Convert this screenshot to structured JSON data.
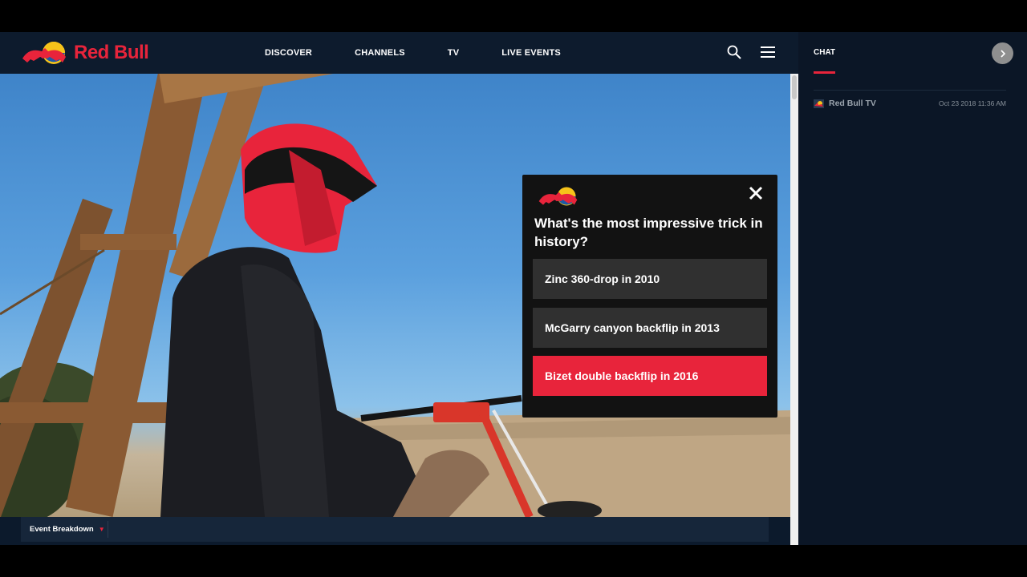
{
  "brand": {
    "name": "Red Bull",
    "red": "#e8243b",
    "navy": "#0d1b2d"
  },
  "nav": {
    "items": [
      "DISCOVER",
      "CHANNELS",
      "TV",
      "LIVE EVENTS"
    ]
  },
  "icons": {
    "search": "search-icon",
    "menu": "hamburger-menu-icon",
    "close": "close-icon",
    "expand": "chevron-right-icon"
  },
  "poll": {
    "question": "What's the most impressive trick in history?",
    "options": [
      "Zinc 360-drop in 2010",
      "McGarry canyon backflip in 2013",
      "Bizet double backflip in 2016"
    ],
    "selected_index": 2
  },
  "bottom": {
    "breakdown_label": "Event Breakdown"
  },
  "chat": {
    "tab_label": "CHAT",
    "messages": [
      {
        "author": "Red Bull TV",
        "time": "Oct 23 2018 11:36 AM"
      }
    ]
  }
}
